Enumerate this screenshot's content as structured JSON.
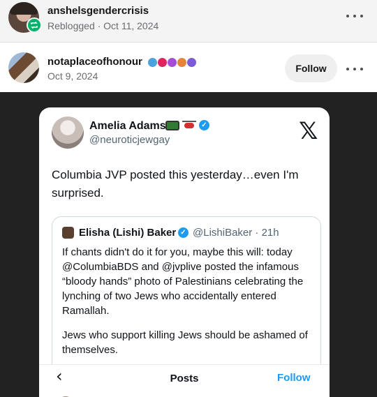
{
  "reblog": {
    "username": "anshelsgendercrisis",
    "meta": "Reblogged · Oct 11, 2024"
  },
  "post": {
    "username": "notaplaceofhonour",
    "date": "Oct 9, 2024",
    "follow_label": "Follow",
    "badge_colors": [
      "#4aa3df",
      "#e0245e",
      "#a64dd8",
      "#e8833a",
      "#7b5cd6"
    ]
  },
  "tweet": {
    "display_name": "Amelia Adams",
    "handle": "@neuroticjewgay",
    "text": "Columbia JVP posted this yesterday…even I'm surprised.",
    "quoted": {
      "name": "Elisha (Lishi) Baker",
      "handle_time": "@LishiBaker · 21h",
      "paragraph1": "If chants didn't do it for you, maybe this will: today @ColumbiaBDS and @jvplive posted the infamous “bloody hands” photo of Palestinians celebrating the lynching of two Jews who accidentally entered Ramallah.",
      "paragraph2": "Jews who support killing Jews should be ashamed of themselves."
    },
    "nav": {
      "title": "Posts",
      "follow_label": "Follow"
    }
  },
  "colors": {
    "follow_green": "#00b36b",
    "twitter_blue": "#1d9bf0"
  }
}
